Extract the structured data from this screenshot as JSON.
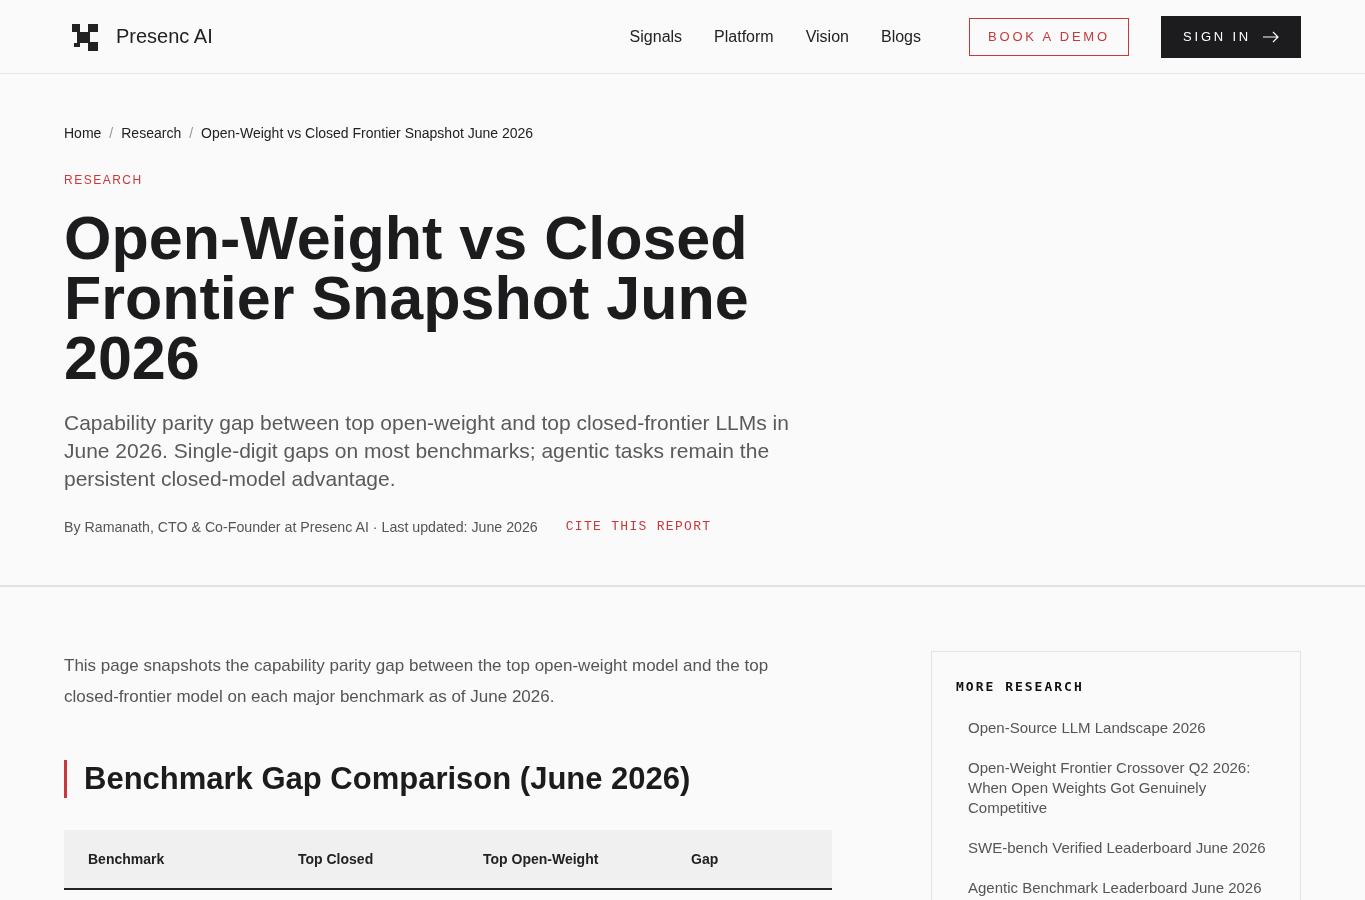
{
  "header": {
    "brand": "Presenc AI",
    "nav": [
      "Signals",
      "Platform",
      "Vision",
      "Blogs"
    ],
    "buttons": [
      {
        "label": "BOOK A DEMO",
        "kind": "outline"
      },
      {
        "label": "SIGN IN",
        "kind": "solid"
      }
    ]
  },
  "hero": {
    "breadcrumbs": {
      "separator": "/",
      "items": [
        "Home",
        "Research",
        "Open-Weight vs Closed Frontier Snapshot June 2026"
      ]
    },
    "category": "RESEARCH",
    "title": "Open-Weight vs Closed Frontier Snapshot June 2026",
    "subtitle": "Capability parity gap between top open-weight and top closed-frontier LLMs in June 2026. Single-digit gaps on most benchmarks; agentic tasks remain the persistent closed-model advantage.",
    "byline": "By Ramanath, CTO & Co-Founder at Presenc AI · Last updated: June 2026",
    "cite_link": "CITE THIS REPORT"
  },
  "article": {
    "intro": "This page snapshots the capability parity gap between the top open-weight model and the top closed-frontier model on each major benchmark as of June 2026.",
    "section_heading": "Benchmark Gap Comparison (June 2026)",
    "table": {
      "columns": [
        "Benchmark",
        "Top Closed",
        "Top Open-Weight",
        "Gap"
      ]
    }
  },
  "sidebar": {
    "title": "MORE RESEARCH",
    "items": [
      "Open-Source LLM Landscape 2026",
      "Open-Weight Frontier Crossover Q2 2026: When Open Weights Got Genuinely Competitive",
      "SWE-bench Verified Leaderboard June 2026",
      "Agentic Benchmark Leaderboard June 2026"
    ]
  }
}
